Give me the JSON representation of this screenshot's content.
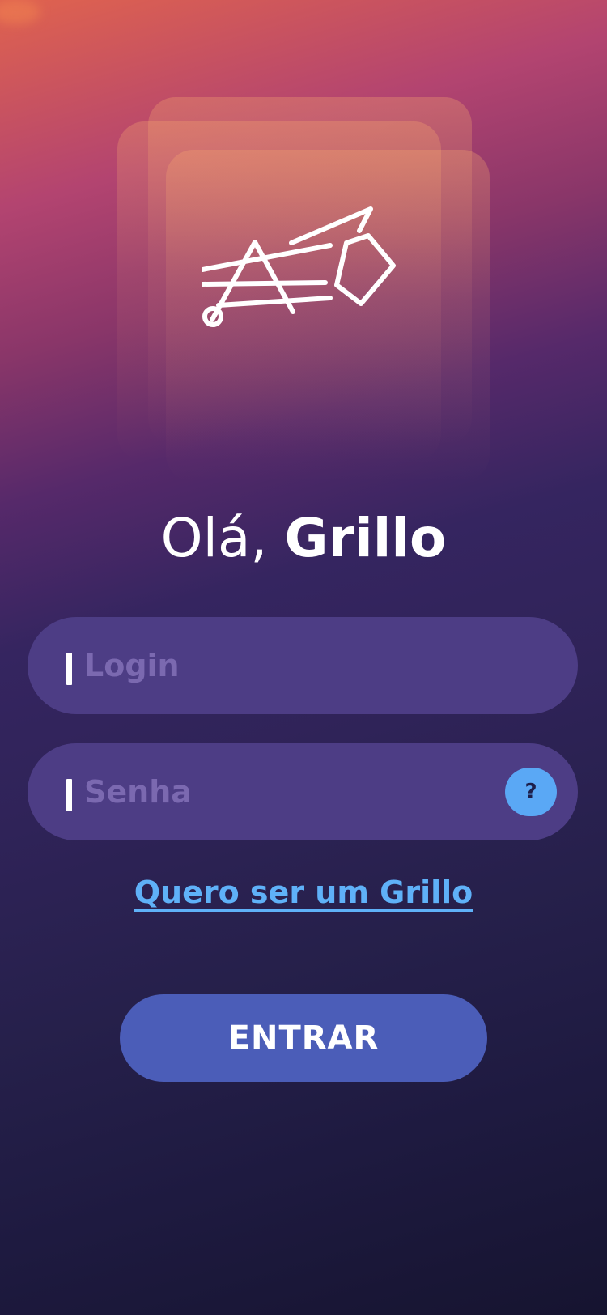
{
  "greeting": {
    "prefix": "Olá,",
    "name": "Grillo"
  },
  "logo": {
    "icon": "grillo-cricket-logo-icon"
  },
  "login": {
    "placeholder": "Login",
    "value": ""
  },
  "password": {
    "placeholder": "Senha",
    "value": "",
    "help_label": "?"
  },
  "signup": {
    "label": "Quero ser um Grillo"
  },
  "submit": {
    "label": "ENTRAR"
  },
  "colors": {
    "field_background": "#4d3d85",
    "placeholder": "#7b69b0",
    "link": "#5fb1f8",
    "help_button": "#5aa8f5",
    "primary_button": "#4b5db8"
  }
}
